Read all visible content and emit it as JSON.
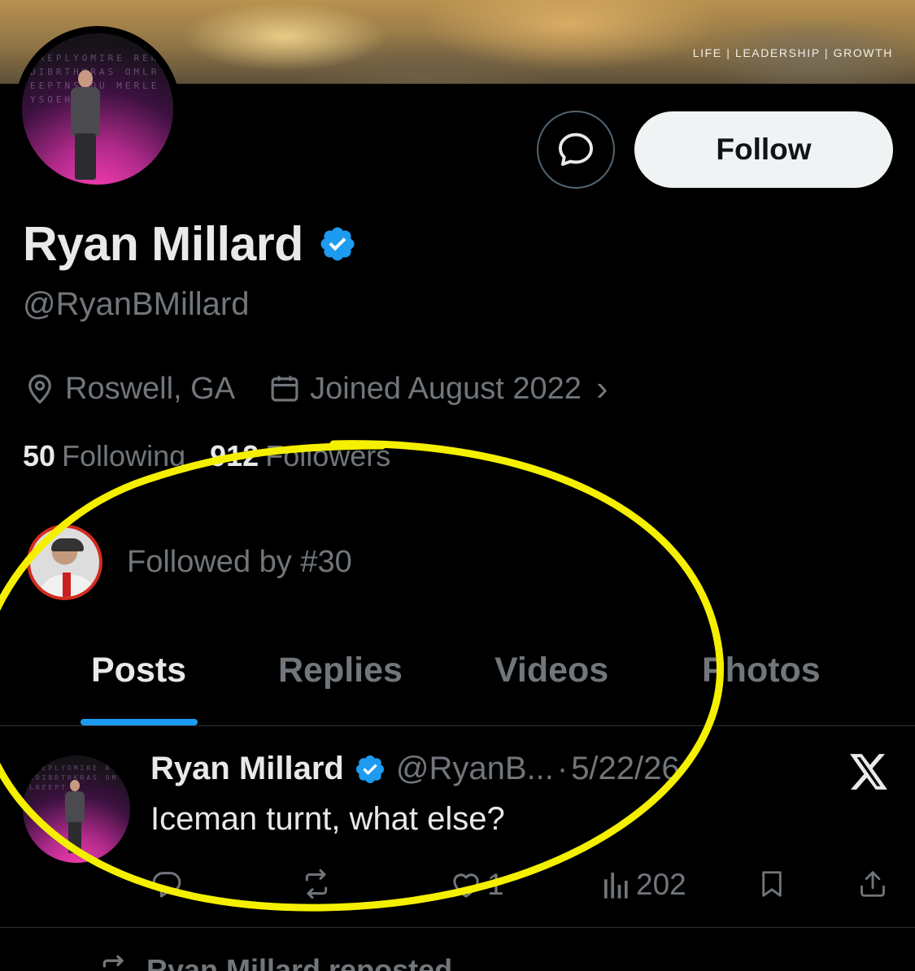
{
  "banner": {
    "tagline": "LIFE | LEADERSHIP | GROWTH"
  },
  "avatar": {
    "letters": "AREPLYOMIRE RENDIBRTHKRAS OMLREEPTNSYOU MERLEYSOEH"
  },
  "profile": {
    "display_name": "Ryan Millard",
    "handle": "@RyanBMillard",
    "location": "Roswell, GA",
    "joined": "Joined August 2022",
    "joined_chevron": "›",
    "following_count": "50",
    "following_label": "Following",
    "followers_count": "912",
    "followers_label": "Followers",
    "followed_by": "Followed by #30"
  },
  "actions": {
    "follow_label": "Follow"
  },
  "tabs": [
    {
      "label": "Posts",
      "active": true
    },
    {
      "label": "Replies",
      "active": false
    },
    {
      "label": "Videos",
      "active": false
    },
    {
      "label": "Photos",
      "active": false
    }
  ],
  "post": {
    "author_name": "Ryan Millard",
    "author_handle": "@RyanB...",
    "separator": "·",
    "date": "5/22/26",
    "text": "Iceman turnt, what else?",
    "likes": "1",
    "views": "202",
    "avatar_letters": "AREPLYOMIRE RENDIBRTHKRAS OMLREEPT"
  },
  "next_post": {
    "reposted_label": "Ryan Millard reposted"
  },
  "colors": {
    "background": "#000000",
    "text_primary": "#e7e9ea",
    "text_secondary": "#71767b",
    "accent_blue": "#1d9bf0",
    "verified_blue": "#1d9bf0",
    "highlight_yellow": "#f5f000",
    "follow_button_bg": "#eff3f4"
  },
  "icons": {
    "message": "message-bubble-icon",
    "verified": "verified-badge-icon",
    "location": "location-pin-icon",
    "calendar": "calendar-icon",
    "x_logo": "x-logo-icon",
    "reply": "reply-icon",
    "repost": "repost-icon",
    "like": "heart-icon",
    "views": "views-bar-icon",
    "bookmark": "bookmark-icon",
    "share": "share-icon"
  }
}
